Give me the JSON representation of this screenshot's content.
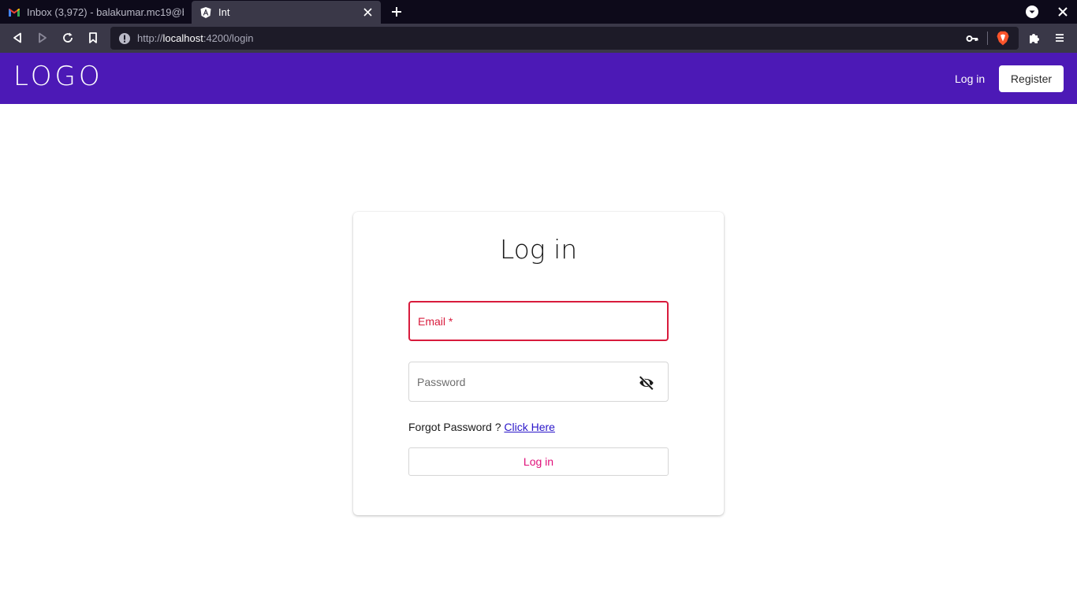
{
  "browser": {
    "tabs": [
      {
        "title": "Inbox (3,972) - balakumar.mc19@b",
        "active": false,
        "favicon": "gmail-icon"
      },
      {
        "title": "Int",
        "active": true,
        "favicon": "angular-icon"
      }
    ],
    "url": {
      "scheme": "http://",
      "host": "localhost",
      "rest": ":4200/login"
    }
  },
  "header": {
    "logo": "LOGO",
    "login_label": "Log in",
    "register_label": "Register",
    "color": "#4c19b6"
  },
  "login_form": {
    "title": "Log in",
    "email_label": "Email *",
    "password_label": "Password",
    "forgot_text": "Forgot Password ?",
    "forgot_link": "Click Here",
    "submit_label": "Log in",
    "error_color": "#d81b3c",
    "accent_color": "#e0117a"
  }
}
